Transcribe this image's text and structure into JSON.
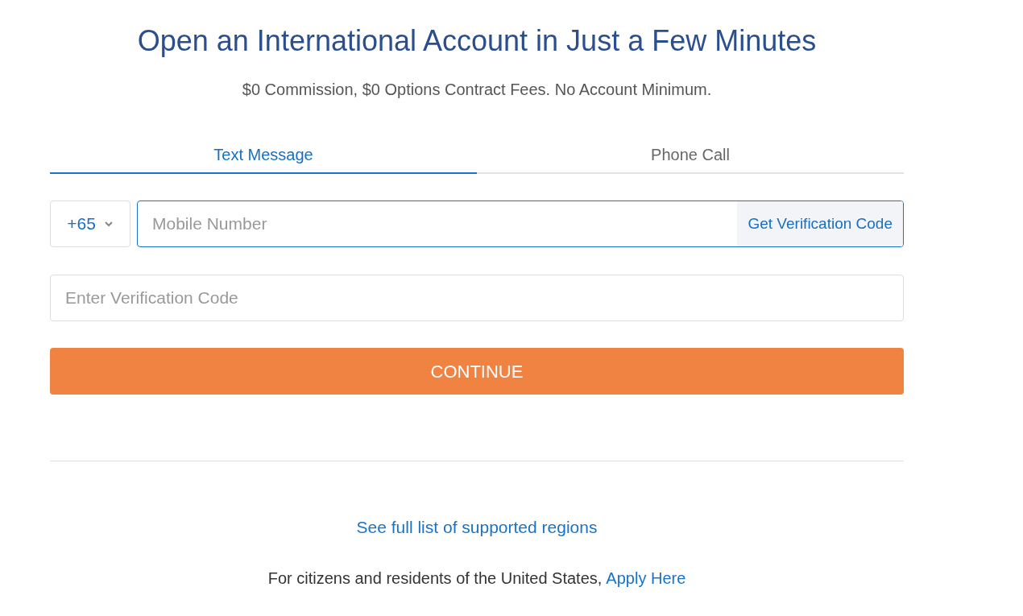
{
  "title": "Open an International Account in Just a Few Minutes",
  "subtitle": "$0 Commission, $0 Options Contract Fees. No Account Minimum.",
  "tabs": [
    {
      "label": "Text Message",
      "selected": true
    },
    {
      "label": "Phone Call",
      "selected": false
    }
  ],
  "phone": {
    "country_code": "+65",
    "placeholder": "Mobile Number",
    "code_button": "Get Verification Code"
  },
  "verification": {
    "placeholder": "Enter Verification Code"
  },
  "continue_button": "CONTINUE",
  "regions_link": "See full list of supported regions",
  "us_note": {
    "text": "For citizens and residents of the United States,",
    "link": "Apply Here"
  }
}
